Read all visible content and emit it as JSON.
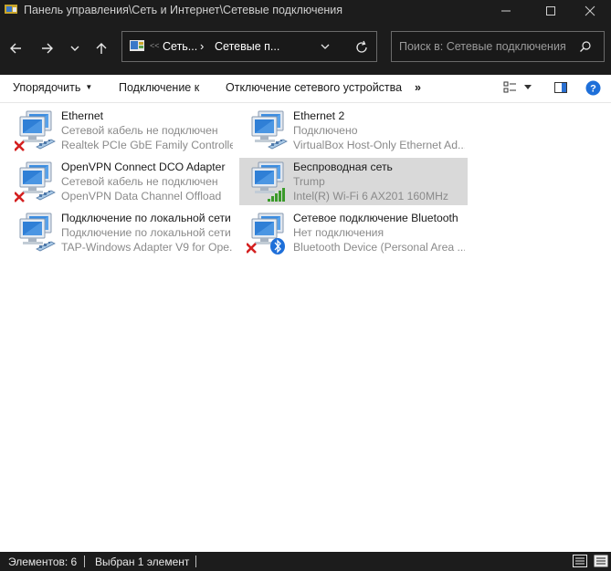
{
  "window": {
    "title": "Панель управления\\Сеть и Интернет\\Сетевые подключения"
  },
  "address": {
    "crumbs": [
      "Сеть...",
      "Сетевые п..."
    ]
  },
  "search": {
    "placeholder": "Поиск в: Сетевые подключения"
  },
  "toolbar": {
    "organize_label": "Упорядочить",
    "connect_label": "Подключение к",
    "disconnect_label": "Отключение сетевого устройства",
    "more_label": "»"
  },
  "connections": [
    {
      "name": "Ethernet",
      "status": "Сетевой кабель не подключен",
      "device": "Realtek PCIe GbE Family Controller",
      "badge": "red-x",
      "selected": false
    },
    {
      "name": "Ethernet 2",
      "status": "Подключено",
      "device": "VirtualBox Host-Only Ethernet Ad...",
      "badge": "cable",
      "selected": false
    },
    {
      "name": "OpenVPN Connect DCO Adapter",
      "status": "Сетевой кабель не подключен",
      "device": "OpenVPN Data Channel Offload",
      "badge": "red-x",
      "selected": false
    },
    {
      "name": "Беспроводная сеть",
      "status": "Trump",
      "device": "Intel(R) Wi-Fi 6 AX201 160MHz",
      "badge": "wifi-bars",
      "selected": true
    },
    {
      "name": "Подключение по локальной сети",
      "status": "Подключение по локальной сети",
      "device": "TAP-Windows Adapter V9 for Ope...",
      "badge": "cable",
      "selected": false
    },
    {
      "name": "Сетевое подключение Bluetooth",
      "status": "Нет подключения",
      "device": "Bluetooth Device (Personal Area ...",
      "badge": "bluetooth-x",
      "selected": false
    }
  ],
  "status": {
    "count": "Элементов: 6",
    "selected": "Выбран 1 элемент"
  },
  "colors": {
    "chrome": "#1c1c1c",
    "selection": "#d9d9d9",
    "error": "#d42020",
    "wifi": "#3a9a2a",
    "bluetooth": "#1e6fd9"
  }
}
